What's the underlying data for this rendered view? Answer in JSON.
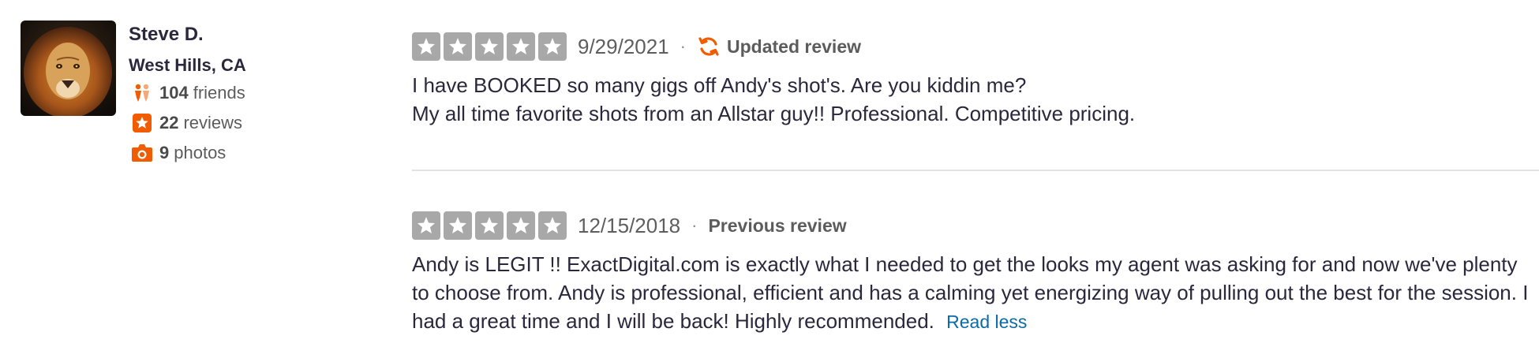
{
  "user": {
    "name": "Steve D.",
    "location": "West Hills, CA",
    "friends_count": "104",
    "friends_label": "friends",
    "reviews_count": "22",
    "reviews_label": "reviews",
    "photos_count": "9",
    "photos_label": "photos"
  },
  "reviews": [
    {
      "rating": 5,
      "date": "9/29/2021",
      "separator": "·",
      "tag": "Updated review",
      "lines": [
        "I have BOOKED so many gigs off Andy's shot's. Are you kiddin me?",
        "My all time favorite shots from an Allstar guy!! Professional. Competitive pricing."
      ]
    },
    {
      "rating": 5,
      "date": "12/15/2018",
      "separator": "·",
      "tag": "Previous review",
      "text": "Andy is LEGIT !! ExactDigital.com is exactly what I needed to get the looks my agent was asking for and now we've plenty to choose from. Andy is professional, efficient and has a calming yet energizing way of pulling out the best for the session. I had a great time and I will be back! Highly recommended.",
      "read_less": "Read less"
    }
  ],
  "colors": {
    "accent_orange": "#f15c00",
    "star_empty_gray": "#a8a8a8",
    "link_blue": "#0a6ba8"
  },
  "icons": {
    "friends": "friends-icon",
    "reviews": "star-badge-icon",
    "photos": "camera-icon",
    "updated": "refresh-icon"
  }
}
